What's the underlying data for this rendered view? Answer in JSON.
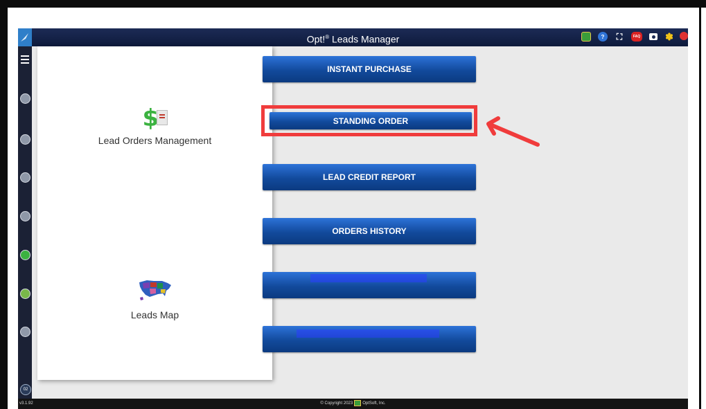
{
  "app": {
    "title": "Opt!",
    "title_sup": "®",
    "title_rest": " Leads Manager",
    "version": "v3.1.92",
    "copyright": "© Copyright 2023",
    "copyright_company": "OptSoft, Inc."
  },
  "topbar_icons": [
    "tools-icon",
    "help-icon",
    "expand-icon",
    "faq-icon",
    "camera-icon",
    "gear-icon",
    "power-icon"
  ],
  "faq_label": "FAQ",
  "sidebar": {
    "badge": "02",
    "items": [
      "home-icon",
      "module-2-icon",
      "module-3-icon",
      "module-4-icon",
      "money-icon",
      "module-6-icon",
      "module-7-icon"
    ]
  },
  "panel": {
    "item1_label": "Lead Orders Management",
    "item2_label": "Leads Map"
  },
  "buttons": {
    "b1": "INSTANT PURCHASE",
    "b2": "STANDING ORDER",
    "b3": "LEAD CREDIT REPORT",
    "b4": "ORDERS HISTORY",
    "b5": "",
    "b6": ""
  },
  "colors": {
    "button_blue": "#124a9c",
    "highlight_red": "#f03c3c",
    "topbar_navy": "#1c2b55"
  }
}
